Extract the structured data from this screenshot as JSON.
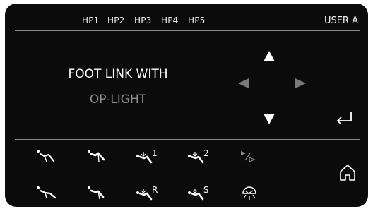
{
  "header": {
    "hp_buttons": [
      "HP1",
      "HP2",
      "HP3",
      "HP4",
      "HP5"
    ],
    "user_label": "USER A"
  },
  "main": {
    "title_line1": "FOOT LINK WITH",
    "title_line2": "OP-LIGHT"
  },
  "toolbar": {
    "row1": [
      {
        "icon": "chair-position-icon",
        "label": ""
      },
      {
        "icon": "chair-position-icon",
        "label": ""
      },
      {
        "icon": "chair-program-icon",
        "label": "1"
      },
      {
        "icon": "chair-program-icon",
        "label": "2"
      },
      {
        "icon": "play-step-icon",
        "label": ""
      }
    ],
    "row2": [
      {
        "icon": "chair-position-icon",
        "label": ""
      },
      {
        "icon": "chair-position-icon",
        "label": ""
      },
      {
        "icon": "chair-program-icon",
        "label": "R"
      },
      {
        "icon": "chair-program-icon",
        "label": "S"
      },
      {
        "icon": "op-light-icon",
        "label": ""
      }
    ]
  },
  "colors": {
    "background": "#0b0b0b",
    "text": "#ffffff",
    "muted": "#8c8c8c",
    "divider": "#8a8a8a"
  }
}
